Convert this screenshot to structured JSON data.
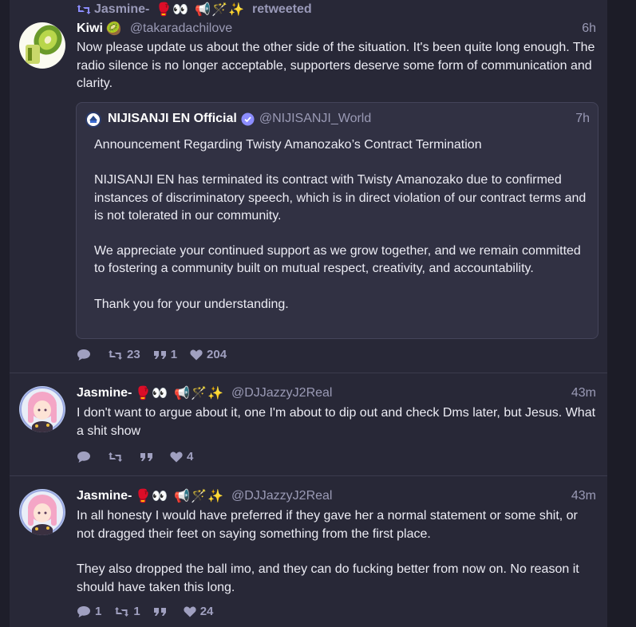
{
  "colors": {
    "background": "#1e1e2a",
    "panel": "#282837",
    "accent": "#8c8dff",
    "muted": "#9a9ab5"
  },
  "reblog": {
    "icon": "retweet-icon",
    "name": "Jasmine-",
    "emoji": [
      "🥊",
      "👀",
      "📢",
      "🪄",
      "✨"
    ],
    "suffix": "retweeted"
  },
  "statuses": [
    {
      "display_name": "Kiwi",
      "emoji": [
        "🥝"
      ],
      "handle": "@takaradachilove",
      "time": "6h",
      "content": [
        "Now please update us about the other side of the situation. It's been quite long enough. The radio silence is no longer acceptable, supporters deserve some form of communication and clarity."
      ],
      "quote": {
        "display_name": "NIJISANJI EN Official",
        "verified": true,
        "handle": "@NIJISANJI_World",
        "time": "7h",
        "content": [
          "Announcement Regarding Twisty Amanozako’s Contract Termination",
          "NIJISANJI EN has terminated its contract with Twisty Amanozako due to confirmed instances of discriminatory speech, which is in direct violation of our contract terms and is not tolerated in our community.",
          "We appreciate your continued support as we grow together, and we remain committed to fostering a community built on mutual respect, creativity, and accountability.",
          "Thank you for your understanding."
        ]
      },
      "actions": {
        "replies": "",
        "reblogs": "23",
        "quotes": "1",
        "likes": "204"
      }
    },
    {
      "display_name": "Jasmine-",
      "emoji": [
        "🥊",
        "👀",
        "📢",
        "🪄",
        "✨"
      ],
      "handle": "@DJJazzyJ2Real",
      "time": "43m",
      "content": [
        "I don't want to argue about it, one I'm about to dip out and check Dms later, but Jesus. What a shit show"
      ],
      "actions": {
        "replies": "",
        "reblogs": "",
        "quotes": "",
        "likes": "4"
      }
    },
    {
      "display_name": "Jasmine-",
      "emoji": [
        "🥊",
        "👀",
        "📢",
        "🪄",
        "✨"
      ],
      "handle": "@DJJazzyJ2Real",
      "time": "43m",
      "content": [
        "In all honesty I would have preferred if they gave her a normal statement or some shit, or not dragged their feet on saying something from the first place.",
        "They also dropped the ball imo, and they can do fucking better from now on. No reason it should have taken this long."
      ],
      "actions": {
        "replies": "1",
        "reblogs": "1",
        "quotes": "",
        "likes": "24"
      }
    }
  ]
}
